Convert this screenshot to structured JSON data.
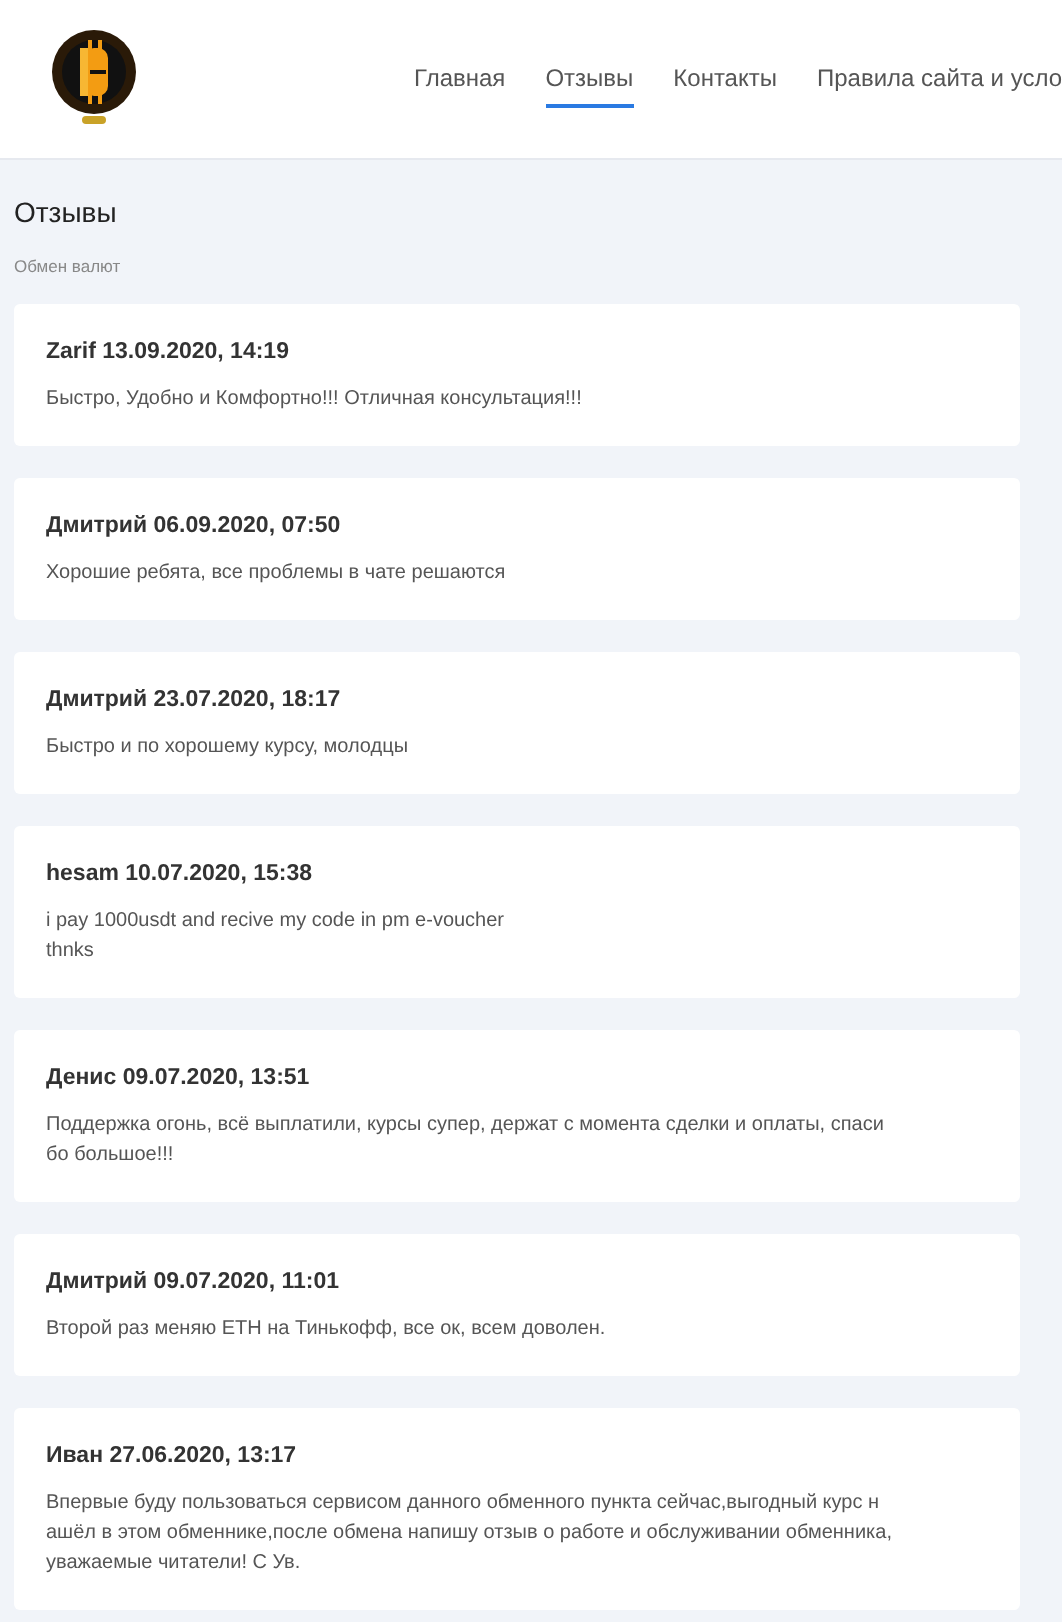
{
  "nav": [
    {
      "label": "Главная",
      "selected": false
    },
    {
      "label": "Отзывы",
      "selected": true
    },
    {
      "label": "Контакты",
      "selected": false
    },
    {
      "label": "Правила сайта и усло",
      "selected": false
    }
  ],
  "page": {
    "title": "Отзывы",
    "breadcrumb": "Обмен валют"
  },
  "reviews": [
    {
      "author": "Zarif 13.09.2020, 14:19",
      "lines": [
        "Быстро, Удобно и Комфортно!!! Отличная консультация!!!"
      ]
    },
    {
      "author": "Дмитрий 06.09.2020, 07:50",
      "lines": [
        "Хорошие ребята, все проблемы в чате решаются"
      ]
    },
    {
      "author": "Дмитрий 23.07.2020, 18:17",
      "lines": [
        "Быстро и по хорошему курсу, молодцы"
      ]
    },
    {
      "author": "hesam 10.07.2020, 15:38",
      "lines": [
        "i pay 1000usdt and recive my code in pm e-voucher",
        "thnks"
      ]
    },
    {
      "author": "Денис 09.07.2020, 13:51",
      "lines": [
        "Поддержка огонь, всё выплатили, курсы супер, держат с момента сделки и оплаты, спаси",
        "бо большое!!!"
      ]
    },
    {
      "author": "Дмитрий 09.07.2020, 11:01",
      "lines": [
        "Второй раз меняю ETH на Тинькофф, все ок, всем доволен."
      ]
    },
    {
      "author": "Иван 27.06.2020, 13:17",
      "lines": [
        "Впервые буду пользоваться сервисом данного обменного пункта сейчас,выгодный курс н",
        "ашёл в этом обменнике,после обмена напишу отзыв о работе и обслуживании обменника,",
        "уважаемые читатели! С Ув."
      ]
    }
  ]
}
